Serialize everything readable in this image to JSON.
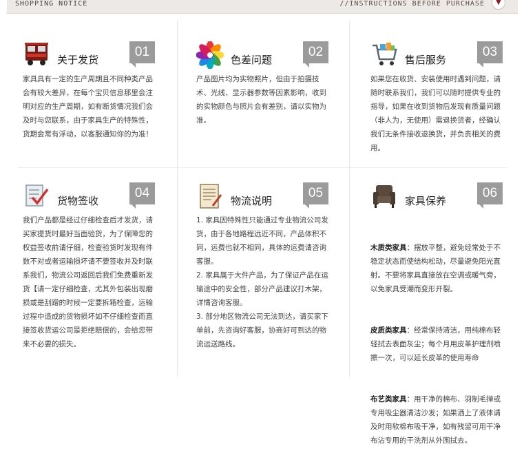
{
  "header": {
    "left_label": "SHOPPING NOTICE",
    "right_label": "//INSTRUCTIONS BEFORE PURCHASE",
    "arrow": "chevron-down-icon"
  },
  "panels": [
    {
      "icon": "truck-icon",
      "title": "关于发货",
      "number": "01",
      "text": "家具具有一定的生产周期且不同种类产品会有较大差异，在每个宝贝信息那里会注明对应的生产周期，如有断货情况我们会及时与您联系，由于家具生产的特殊性，货期会常有浮动，以客服通知你的为准！"
    },
    {
      "icon": "color-palette-icon",
      "title": "色差问题",
      "number": "02",
      "text": "产品图片均为实物照片，但由于拍摄技术、光线、显示器参数等因素影响，收到的实物颜色与照片会有差别，请以实物为准。"
    },
    {
      "icon": "shopping-cart-icon",
      "title": "售后服务",
      "number": "03",
      "text": "如果您在收货、安装使用时遇到问题，请随时联系我们，我们可以随时提供专业的指导，如果在收到货物后发现有质量问题（非人为，无使用）需退换货者，经确认我们无条件接收退换货，并负责相关的费用。"
    },
    {
      "icon": "checklist-icon",
      "title": "货物签收",
      "number": "04",
      "text": "我们产品都是经过仔细检查后才发货，请买家提货时最好当面验货，为了保障您的权益签收前请仔细，检查验货时发现有件数不对或者运输损坏请不要签收并及时联系我们，物流公司返回后我们免费重新发货【请一定仔细检查，尤其外包装出现磨损或是刮蹭的时候一定要拆箱检查，运输过程中造成的货物损坏如不仔细检查而直接签收货运公司是拒绝赔偿的，会给您带来不必要的损失。"
    },
    {
      "icon": "document-icon",
      "title": "物流说明",
      "number": "05",
      "text": "1. 家具因特殊性只能通过专业物流公司发货，由于各地路程远近不同，产品体积不同，运费也就不相同，具体的运费请咨询客服。\n2. 家具属于大件产品，为了保证产品在运输途中的安全性，部分产品建议打木架，详情咨询客服。\n3. 部分地区物流公司无法到达，请买家下单前，先咨询好客服，协商好可到达的物流运送路线。"
    },
    {
      "icon": "armchair-icon",
      "title": "家具保养",
      "number": "06",
      "sections": [
        {
          "label": "木质类家具",
          "text": "：摆放平整，避免经常处于不稳定状态而使结构松动，尽量避免阳光直射。不要将家具直接放在空调或暖气旁，以免家具受潮而变形开裂。"
        },
        {
          "label": "皮质类家具",
          "text": "：经常保持清洁，用纯棉布轻轻拭去表面灰尘；每个月用皮革护理剂喷擦一次，可以延长皮革的使用寿命"
        },
        {
          "label": "布艺类家具",
          "text": "：用干净的棉布、羽制毛掸或专用吸尘器清洁沙发；如果洒上了液体请及时用软棉布吸干净，如有残留可用干净布沾专用的干洗剂从外围拭去。"
        }
      ]
    }
  ]
}
